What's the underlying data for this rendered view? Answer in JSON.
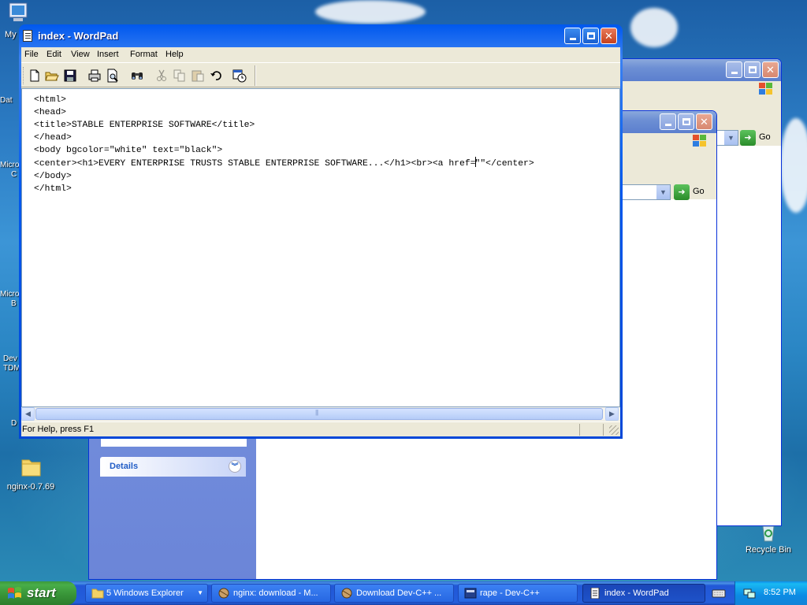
{
  "desktop": {
    "icons": {
      "my_computer": "My",
      "nginx_folder": "nginx-0.7.69",
      "recycle_bin": "Recycle Bin"
    },
    "partial_labels": [
      "Dat",
      "Micro",
      "C",
      "Micro",
      "B",
      "Dev",
      "TDM",
      "D"
    ]
  },
  "explorer_window": {
    "go_label": "Go",
    "details_label": "Details"
  },
  "explorer_window_back": {
    "go_label": "Go"
  },
  "wordpad": {
    "title": "index - WordPad",
    "menu": [
      "File",
      "Edit",
      "View",
      "Insert",
      "Format",
      "Help"
    ],
    "toolbar_icons": [
      "new-doc-icon",
      "open-folder-icon",
      "save-icon",
      "print-icon",
      "print-preview-icon",
      "find-icon",
      "cut-icon",
      "copy-icon",
      "paste-icon",
      "undo-icon",
      "date-time-icon"
    ],
    "lines": [
      "<html>",
      "<head>",
      "<title>STABLE ENTERPRISE SOFTWARE</title>",
      "</head>",
      "<body bgcolor=\"white\" text=\"black\">",
      "<center><h1>EVERY ENTERPRISE TRUSTS STABLE ENTERPRISE SOFTWARE...</h1><br><a href=",
      "\"\"</center>",
      "</body>",
      "</html>"
    ],
    "status_text": "For Help, press F1"
  },
  "taskbar": {
    "start_label": "start",
    "tasks": [
      "5 Windows Explorer",
      "nginx: download - M...",
      "Download Dev-C++ ...",
      "rape - Dev-C++",
      "index - WordPad"
    ],
    "clock": "8:52 PM"
  },
  "colors": {
    "titlebar_active": "#0058ee",
    "frame_face": "#ece9d8",
    "taskbar": "#245edb",
    "start_green": "#3c9a3c"
  }
}
